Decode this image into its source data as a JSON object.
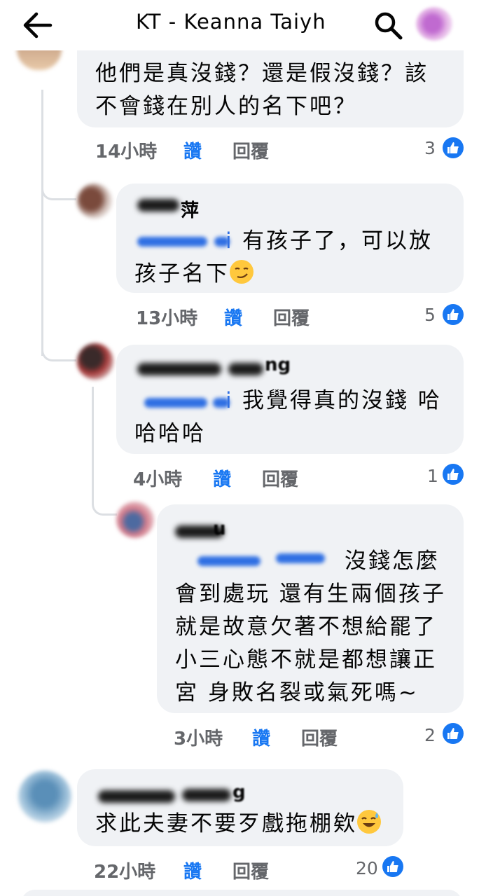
{
  "header": {
    "title": "KT - Keanna Taiyh",
    "back_icon": "back-arrow-icon",
    "search_icon": "search-icon"
  },
  "comments": [
    {
      "text_lines": [
        "他們是真沒錢？還是假沒錢？該",
        "不會錢在別人的名下吧？"
      ],
      "time": "14小時",
      "like_label": "讚",
      "reply_label": "回覆",
      "reactions": "3"
    },
    {
      "name": "萍",
      "mention_suffix": "i",
      "text_lines": [
        "有孩子了，可以放",
        "孩子名下"
      ],
      "time": "13小時",
      "like_label": "讚",
      "reply_label": "回覆",
      "reactions": "5"
    },
    {
      "name": "ng",
      "mention_suffix": "i",
      "text_lines": [
        "我覺得真的沒錢 哈",
        "哈哈哈"
      ],
      "time": "4小時",
      "like_label": "讚",
      "reply_label": "回覆",
      "reactions": "1"
    },
    {
      "name": "u",
      "text_lines": [
        "沒錢怎麼",
        "會到處玩 還有生兩個孩子",
        "就是故意欠著不想給罷了",
        "小三心態不就是都想讓正",
        "宮 身敗名裂或氣死嗎~"
      ],
      "time": "3小時",
      "like_label": "讚",
      "reply_label": "回覆",
      "reactions": "2"
    },
    {
      "name": "g",
      "text_lines": [
        "求此夫妻不要歹戲拖棚欸"
      ],
      "time": "22小時",
      "like_label": "讚",
      "reply_label": "回覆",
      "reactions": "20"
    }
  ],
  "colors": {
    "accent": "#1877f2",
    "bubble": "#f0f2f5",
    "meta": "#65676b"
  }
}
